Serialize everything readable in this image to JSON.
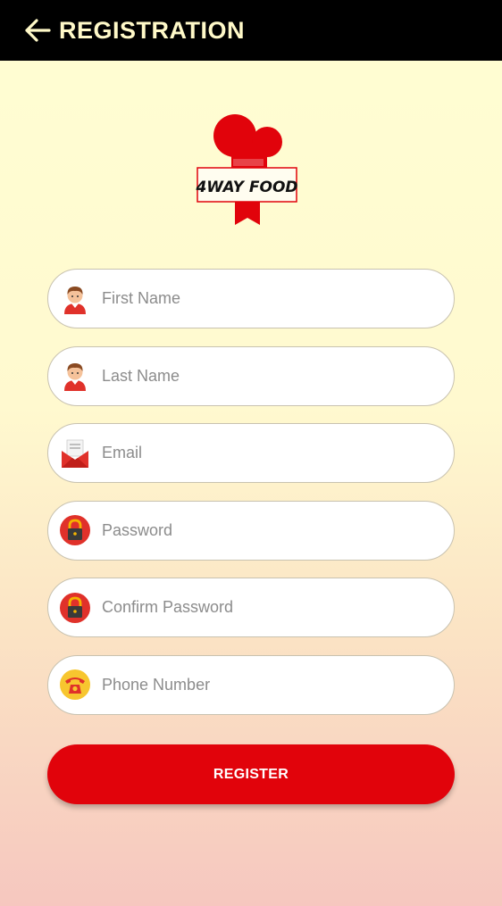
{
  "header": {
    "title": "REGISTRATION",
    "back_icon": "arrow-left-icon"
  },
  "logo": {
    "text": "4WAY FOOD",
    "icon": "chef-hat-logo",
    "brand_color": "#e1030b"
  },
  "form": {
    "first_name": {
      "placeholder": "First Name",
      "value": "",
      "icon": "user-avatar-icon"
    },
    "last_name": {
      "placeholder": "Last Name",
      "value": "",
      "icon": "user-avatar-icon"
    },
    "email": {
      "placeholder": "Email",
      "value": "",
      "icon": "envelope-icon"
    },
    "password": {
      "placeholder": "Password",
      "value": "",
      "icon": "padlock-icon"
    },
    "confirm_password": {
      "placeholder": "Confirm Password",
      "value": "",
      "icon": "padlock-icon"
    },
    "phone": {
      "placeholder": "Phone Number",
      "value": "",
      "icon": "telephone-icon"
    }
  },
  "register_button": {
    "label": "REGISTER"
  },
  "colors": {
    "appbar": "#000000",
    "title": "#fff9c8",
    "accent": "#e1030b",
    "background_top": "#fffed3",
    "background_bottom": "#f6c7bf"
  }
}
